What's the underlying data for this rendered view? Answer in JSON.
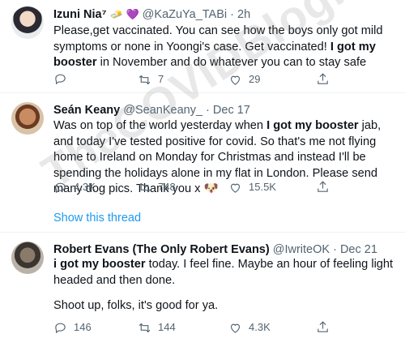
{
  "tweets": [
    {
      "name": "Izuni Nia⁷",
      "emojis": "🧈 💜",
      "handle": "@KaZuYa_TABi",
      "dot": "·",
      "date": "2h",
      "text_before": "Please,get vaccinated. You can see how the boys only got mild symptoms or none in Yoongi's case. Get vaccinated! ",
      "text_bold": "I got my booster",
      "text_after": " in November and do whatever you can to stay safe",
      "replies": "",
      "retweets": "7",
      "likes": "29"
    },
    {
      "name": "Seán Keany",
      "handle": "@SeanKeany_",
      "dot": "·",
      "date": "Dec 17",
      "text_before": "Was on top of the world yesterday when ",
      "text_bold": "I got my booster",
      "text_after": " jab, and today I've tested positive for covid. So that's me not flying home to Ireland on Monday for Christmas and instead I'll be spending the holidays alone in my flat in London. Please send many dog pics. Thank you x 🐶",
      "replies": "4.3K",
      "retweets": "748",
      "likes": "15.5K",
      "show_thread": "Show this thread"
    },
    {
      "name": "Robert Evans (The Only Robert Evans)",
      "handle": "@IwriteOK",
      "dot": "·",
      "date": "Dec 21",
      "text_bold": "i got my booster",
      "text_after": " today. I feel fine. Maybe an hour of feeling light headed and then done.",
      "text_line2": "Shoot up, folks, it's good for ya.",
      "replies": "146",
      "retweets": "144",
      "likes": "4.3K"
    }
  ],
  "watermark": "TheCOVIDBlog.com",
  "colors": {
    "muted": "#536471",
    "link": "#1d9bf0",
    "text": "#0f1419"
  }
}
